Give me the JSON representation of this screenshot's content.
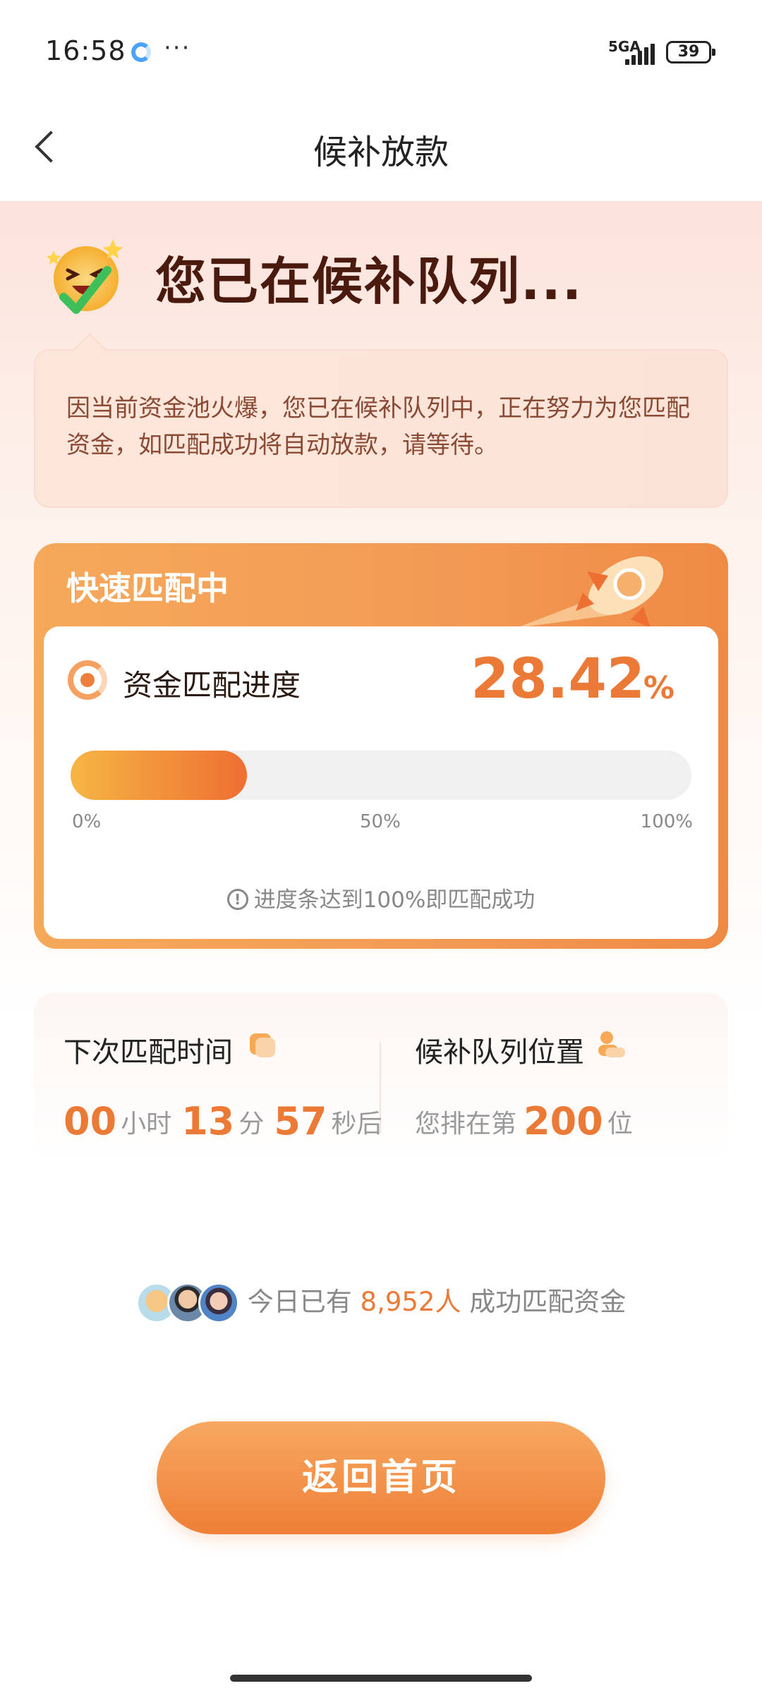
{
  "status_bar": {
    "time": "16:58",
    "more": "···",
    "network": "5GA",
    "battery": "39"
  },
  "nav": {
    "title": "候补放款"
  },
  "hero": {
    "title": "您已在候补队列..."
  },
  "info": {
    "text": "因当前资金池火爆，您已在候补队列中，正在努力为您匹配资金，如匹配成功将自动放款，请等待。"
  },
  "match": {
    "title": "快速匹配中",
    "progress_label": "资金匹配进度",
    "progress_value": "28.42",
    "progress_unit": "%",
    "progress_fraction": 0.2842,
    "ticks": [
      "0%",
      "50%",
      "100%"
    ],
    "hint": "进度条达到100%即匹配成功"
  },
  "stats": {
    "next_match": {
      "title": "下次匹配时间",
      "hours": "00",
      "hours_unit": "小时",
      "minutes": "13",
      "minutes_unit": "分",
      "seconds": "57",
      "seconds_unit": "秒后"
    },
    "queue": {
      "title": "候补队列位置",
      "prefix": "您排在第",
      "position": "200",
      "suffix": "位"
    }
  },
  "social": {
    "prefix": "今日已有",
    "count": "8,952人",
    "suffix": "成功匹配资金"
  },
  "button": {
    "label": "返回首页"
  },
  "colors": {
    "accent": "#ec7a37",
    "hero_title": "#4a1a0f"
  }
}
